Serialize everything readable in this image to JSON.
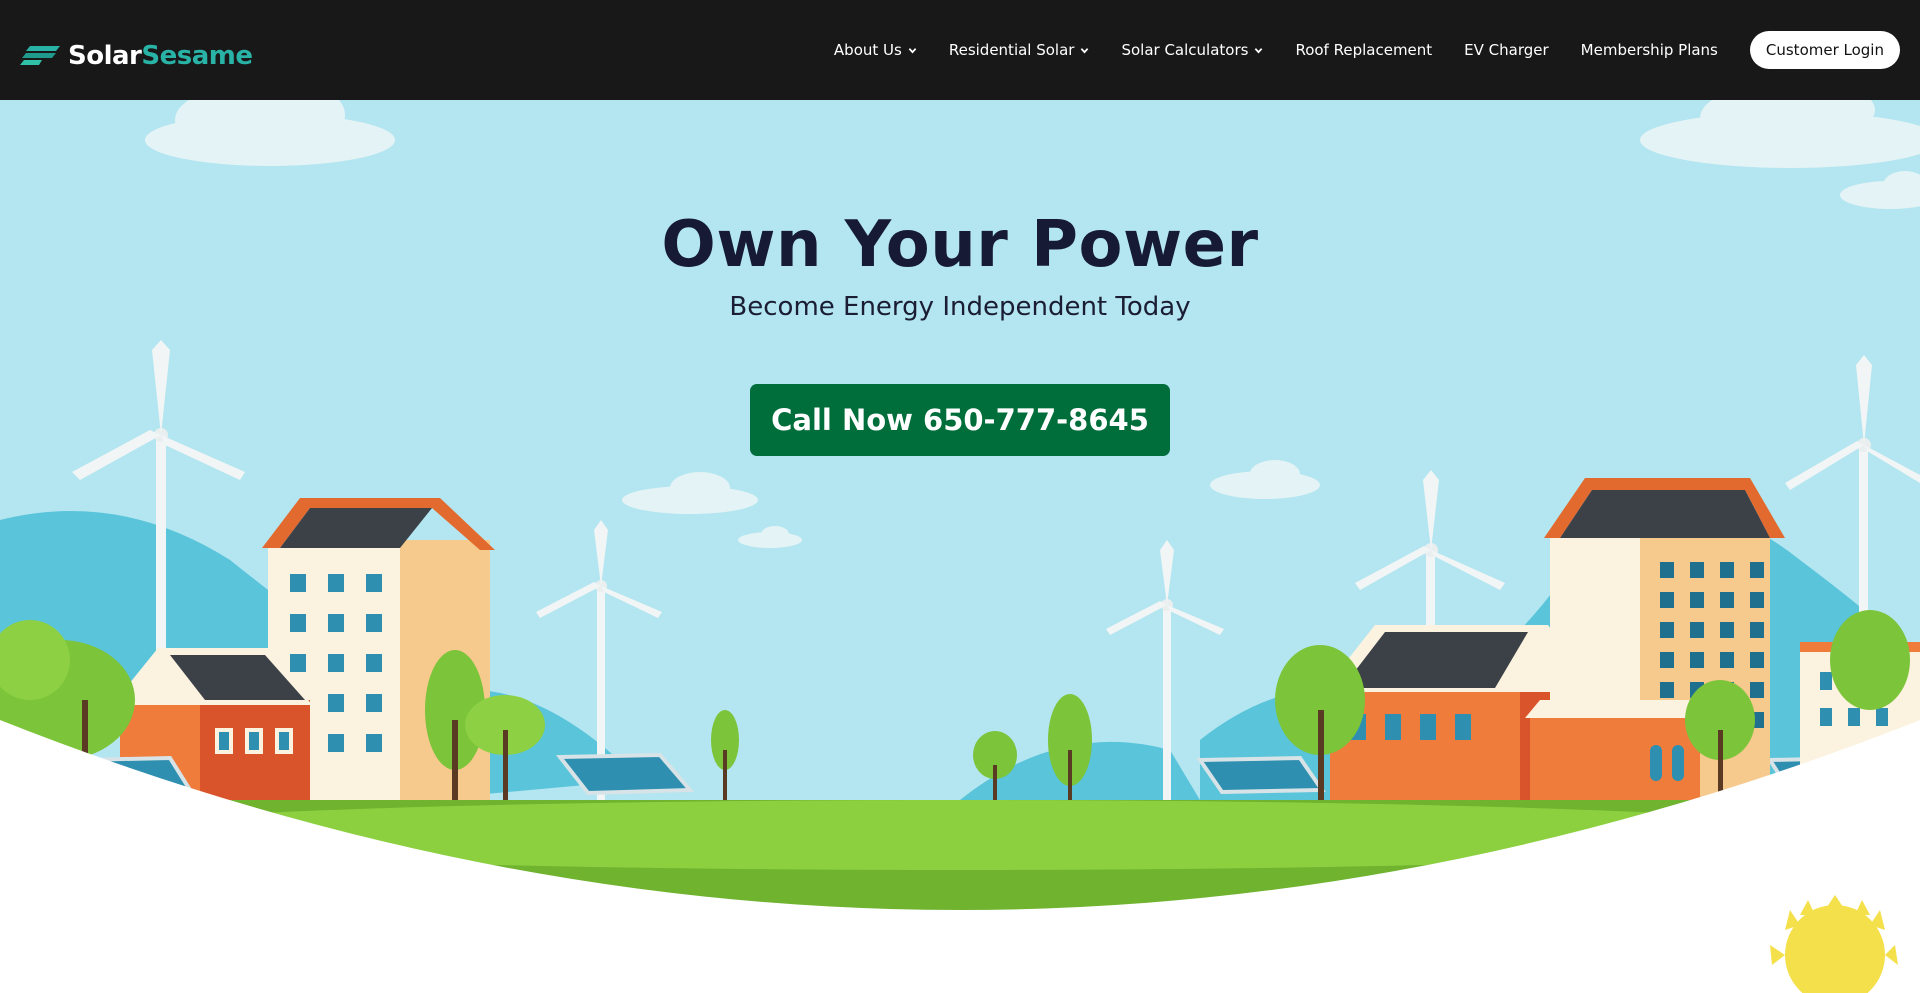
{
  "brand": {
    "name_part1": "Solar",
    "name_part2": "Sesame",
    "logo_icon": "solar-panel-stripes-icon",
    "accent_color": "#29b3a6"
  },
  "nav": {
    "items": [
      {
        "label": "About Us",
        "has_dropdown": true
      },
      {
        "label": "Residential Solar",
        "has_dropdown": true
      },
      {
        "label": "Solar Calculators",
        "has_dropdown": true
      },
      {
        "label": "Roof Replacement",
        "has_dropdown": false
      },
      {
        "label": "EV Charger",
        "has_dropdown": false
      },
      {
        "label": "Membership Plans",
        "has_dropdown": false
      }
    ],
    "login_label": "Customer Login"
  },
  "hero": {
    "title": "Own Your Power",
    "subtitle": "Become Energy Independent Today",
    "cta_label": "Call Now 650-777-8645",
    "cta_color": "#006e3a",
    "sky_color": "#b3e6f0",
    "grass_color": "#7cc43a"
  }
}
